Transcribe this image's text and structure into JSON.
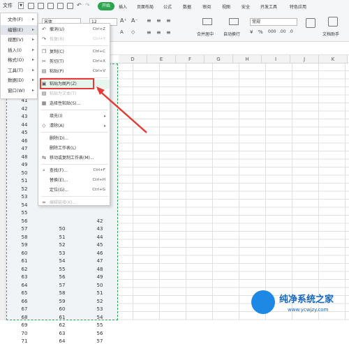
{
  "ribbon": {
    "file_label": "文件",
    "start_tab": "开始",
    "tabs": [
      "插入",
      "页面布局",
      "公式",
      "数据",
      "审阅",
      "视图",
      "安全",
      "开发工具",
      "特色应用"
    ],
    "font_name": "宋体",
    "font_size": "12",
    "format_value": "常规",
    "merge_label": "合并居中",
    "wrap_label": "自动换行",
    "doc_assist_label": "文档助手",
    "accent_color": "#2da44e"
  },
  "navmenu": {
    "items": [
      {
        "label": "文件(F)"
      },
      {
        "label": "编辑(E)"
      },
      {
        "label": "视图(V)"
      },
      {
        "label": "插入(I)"
      },
      {
        "label": "格式(O)"
      },
      {
        "label": "工具(T)"
      },
      {
        "label": "数据(D)"
      },
      {
        "label": "窗口(W)"
      }
    ]
  },
  "columns": [
    "D",
    "E",
    "F",
    "G",
    "H",
    "I",
    "J",
    "K"
  ],
  "col_a_values": [
    "41",
    "42",
    "43",
    "44",
    "45",
    "46",
    "47",
    "48",
    "49",
    "50",
    "51",
    "52",
    "53",
    "54",
    "55",
    "56",
    "57",
    "58",
    "59",
    "60",
    "61",
    "62",
    "63",
    "64",
    "65",
    "66",
    "67",
    "68",
    "69",
    "70",
    "71"
  ],
  "col_b_values": [
    "50",
    "51",
    "52",
    "53",
    "54",
    "55",
    "56",
    "57",
    "58",
    "59",
    "60",
    "61",
    "62",
    "63",
    "64"
  ],
  "col_c_values": [
    "42",
    "43",
    "44",
    "45",
    "46",
    "47",
    "48",
    "49",
    "50",
    "51",
    "52",
    "53",
    "54",
    "55",
    "56",
    "57"
  ],
  "context_menu": {
    "items": [
      {
        "label": "撤消(U)",
        "shortcut": "Ctrl+Z",
        "icon": "undo-icon",
        "disabled": false
      },
      {
        "label": "恢复(R)",
        "shortcut": "Ctrl+Y",
        "icon": "redo-icon",
        "disabled": true
      },
      {
        "label": "复制(C)",
        "shortcut": "Ctrl+C",
        "icon": "copy-icon",
        "disabled": false
      },
      {
        "label": "剪切(T)",
        "shortcut": "Ctrl+X",
        "icon": "cut-icon",
        "disabled": false
      },
      {
        "label": "粘贴(P)",
        "shortcut": "Ctrl+V",
        "icon": "paste-icon",
        "disabled": false
      },
      {
        "label": "粘贴为图片(Z)",
        "shortcut": "",
        "icon": "paste-picture-icon",
        "disabled": false
      },
      {
        "label": "粘贴为文本(T)",
        "shortcut": "",
        "icon": "paste-text-icon",
        "disabled": true
      },
      {
        "label": "选择性粘贴(S)...",
        "shortcut": "",
        "icon": "paste-special-icon",
        "disabled": false
      },
      {
        "label": "填充(I)",
        "shortcut": "",
        "icon": "",
        "disabled": false,
        "submenu": true
      },
      {
        "label": "清除(A)",
        "shortcut": "",
        "icon": "eraser-icon",
        "disabled": false,
        "submenu": true
      },
      {
        "label": "删除(D)...",
        "shortcut": "",
        "icon": "",
        "disabled": false
      },
      {
        "label": "删除工作表(L)",
        "shortcut": "",
        "icon": "",
        "disabled": false
      },
      {
        "label": "移动或复制工作表(M)...",
        "shortcut": "",
        "icon": "move-sheet-icon",
        "disabled": false
      },
      {
        "label": "查找(F)...",
        "shortcut": "Ctrl+F",
        "icon": "find-icon",
        "disabled": false
      },
      {
        "label": "替换(E)...",
        "shortcut": "Ctrl+H",
        "icon": "",
        "disabled": false
      },
      {
        "label": "定位(G)...",
        "shortcut": "Ctrl+G",
        "icon": "",
        "disabled": false
      },
      {
        "label": "编辑链接(K)...",
        "shortcut": "",
        "icon": "link-icon",
        "disabled": true
      }
    ]
  },
  "watermark": {
    "title": "纯净系统之家",
    "url": "www.ycwjzy.com"
  }
}
